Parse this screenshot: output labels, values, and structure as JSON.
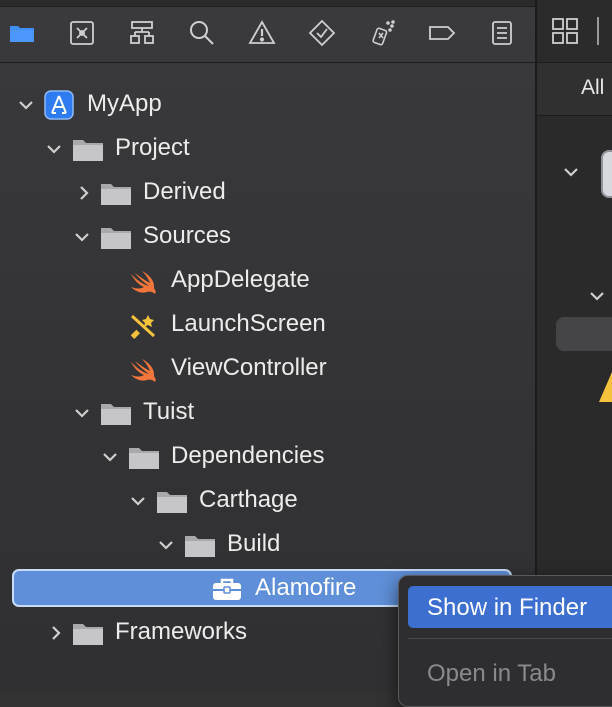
{
  "navigator": {
    "toolbar_icons": [
      {
        "name": "folder-icon",
        "selected": true
      },
      {
        "name": "source-control-icon"
      },
      {
        "name": "hierarchy-icon"
      },
      {
        "name": "search-icon"
      },
      {
        "name": "warning-icon"
      },
      {
        "name": "test-diamond-icon"
      },
      {
        "name": "debug-spray-icon"
      },
      {
        "name": "breakpoint-tag-icon"
      },
      {
        "name": "report-list-icon"
      }
    ],
    "tree": [
      {
        "label": "MyApp",
        "icon": "xcode-app-icon",
        "expanded": true
      },
      {
        "label": "Project",
        "icon": "folder-icon",
        "expanded": true
      },
      {
        "label": "Derived",
        "icon": "folder-icon",
        "expanded": false
      },
      {
        "label": "Sources",
        "icon": "folder-icon",
        "expanded": true
      },
      {
        "label": "AppDelegate",
        "icon": "swift-icon"
      },
      {
        "label": "LaunchScreen",
        "icon": "storyboard-icon"
      },
      {
        "label": "ViewController",
        "icon": "swift-icon"
      },
      {
        "label": "Tuist",
        "icon": "folder-icon",
        "expanded": true
      },
      {
        "label": "Dependencies",
        "icon": "folder-icon",
        "expanded": true
      },
      {
        "label": "Carthage",
        "icon": "folder-icon",
        "expanded": true
      },
      {
        "label": "Build",
        "icon": "folder-icon",
        "expanded": true
      },
      {
        "label": "Alamofire",
        "icon": "framework-toolbox-icon",
        "selected": true
      },
      {
        "label": "Frameworks",
        "icon": "folder-icon",
        "expanded": false
      }
    ]
  },
  "editor": {
    "filter_all": "All"
  },
  "context_menu": {
    "items": [
      "Show in Finder",
      "Open in Tab"
    ]
  },
  "colors": {
    "selection": "#5f8fd8",
    "menu_highlight": "#3c6fd0",
    "accent_folder": "#3f8ef7",
    "swift": "#f0763b",
    "warning": "#f5c33b"
  }
}
